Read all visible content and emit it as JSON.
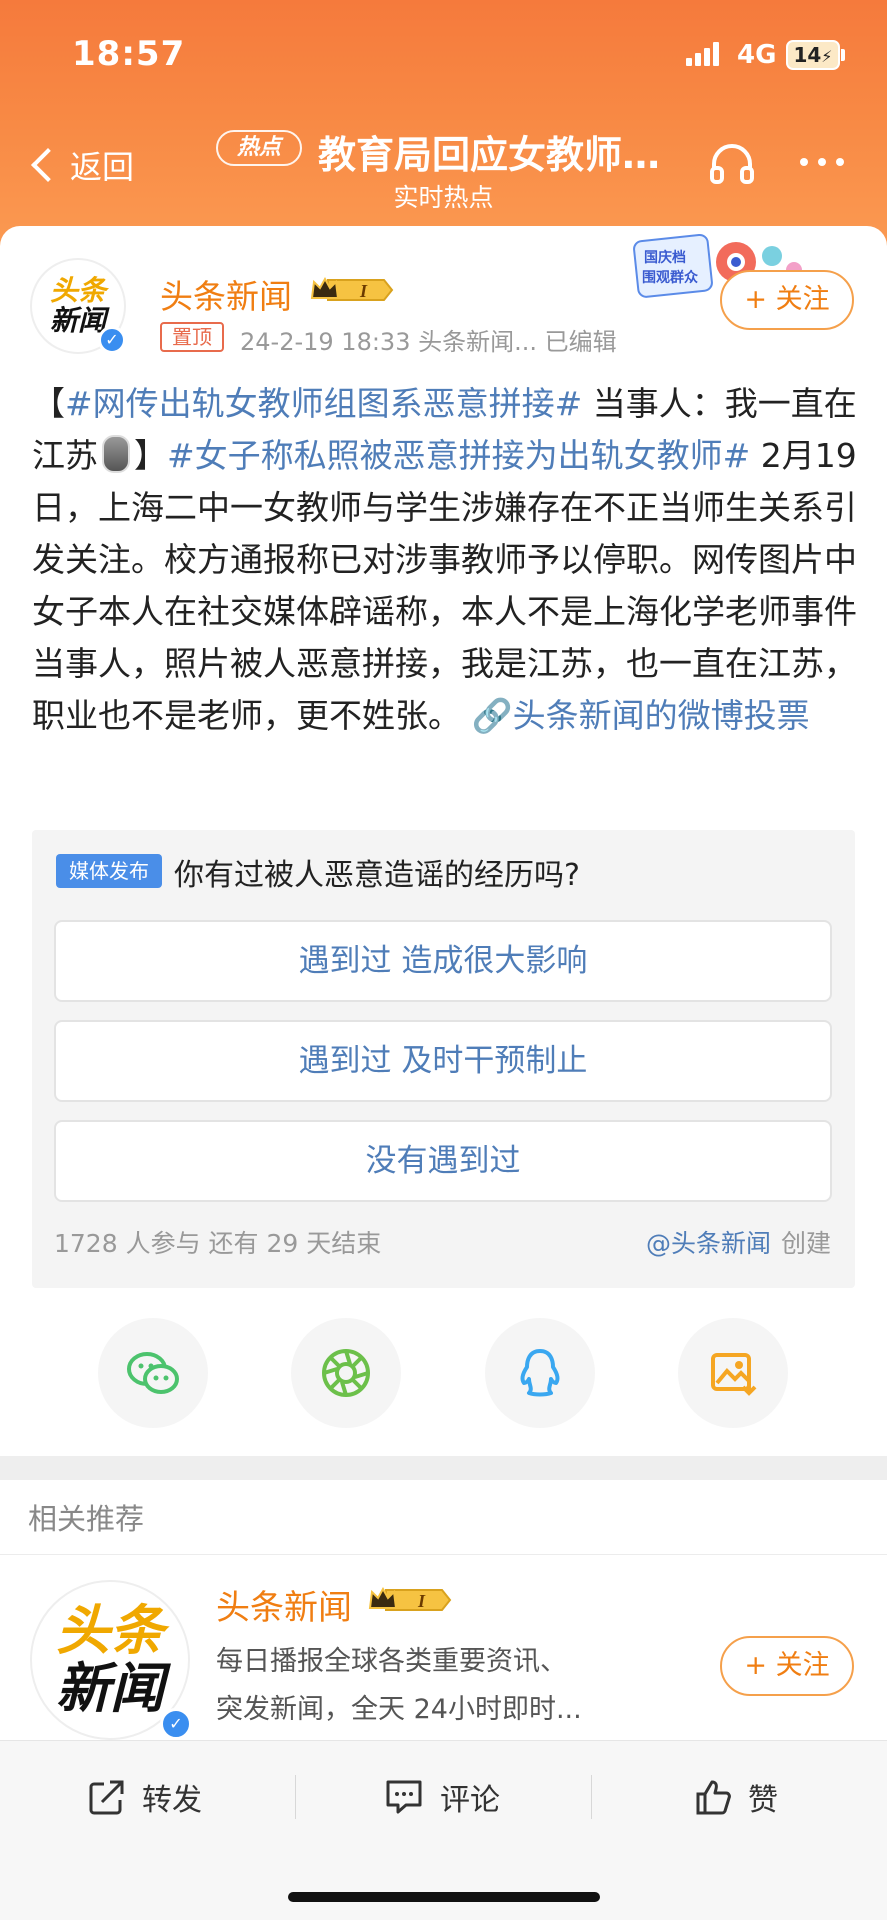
{
  "status_bar": {
    "time": "18:57",
    "network": "4G",
    "battery": "14"
  },
  "nav": {
    "back_label": "返回",
    "hot_badge": "热点",
    "title": "教育局回应女教师…",
    "subtitle": "实时热点",
    "icons": [
      "headphone-icon",
      "more-icon"
    ]
  },
  "post": {
    "author": "头条新闻",
    "author_avatar_lines": [
      "头条",
      "新闻"
    ],
    "badge_level": "I",
    "pinned_tag": "置顶",
    "meta": "24-2-19 18:33  头条新闻...  已编辑",
    "promo_sticker": [
      "国庆档",
      "围观群众"
    ],
    "follow_label": "+ 关注",
    "body": {
      "p1": "【",
      "tag1": "#网传出轨女教师组图系恶意拼接#",
      "p2": " 当事人：我一直在江苏",
      "p3": "】",
      "tag2": "#女子称私照被恶意拼接为出轨女教师#",
      "p4": " 2月19日，上海二中一女教师与学生涉嫌存在不正当师生关系引发关注。校方通报称已对涉事教师予以停职。网传图片中女子本人在社交媒体辟谣称，本人不是上海化学老师事件当事人，照片被人恶意拼接，我是江苏，也一直在江苏，职业也不是老师，更不姓张。 ",
      "vote_link": "头条新闻的微博投票"
    }
  },
  "poll": {
    "tag": "媒体发布",
    "question": "你有过被人恶意造谣的经历吗?",
    "options": [
      {
        "label": "遇到过 造成很大影响"
      },
      {
        "label": "遇到过 及时干预制止"
      },
      {
        "label": "没有遇到过"
      }
    ],
    "stats": "1728 人参与   还有 29 天结束",
    "creator_name": "@头条新闻",
    "creator_suffix": "创建"
  },
  "share": {
    "icons": [
      "wechat-icon",
      "moments-icon",
      "qq-icon",
      "save-image-icon"
    ],
    "colors": {
      "wechat": "#4cc36d",
      "moments": "#6cc04a",
      "qq": "#3aa7f0",
      "save": "#f5a623"
    }
  },
  "related": {
    "section_title": "相关推荐",
    "name": "头条新闻",
    "badge_level": "I",
    "desc_line1": "每日播报全球各类重要资讯、",
    "desc_line2": "突发新闻，全天 24小时即时...",
    "follow_label": "+ 关注"
  },
  "bottom_bar": {
    "repost": "转发",
    "comment": "评论",
    "like": "赞"
  },
  "colors": {
    "header_orange": "#f57a3c",
    "brand_orange": "#f07e12",
    "link_blue": "#4f7db8",
    "verified_blue": "#3a8ef0"
  }
}
